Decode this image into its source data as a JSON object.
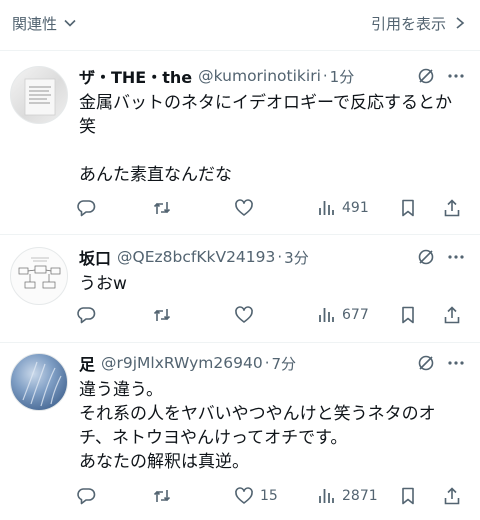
{
  "topbar": {
    "sort_label": "関連性",
    "quote_label": "引用を表示"
  },
  "replies": [
    {
      "name": "ザ・THE・the",
      "handle": "@kumorinotikiri",
      "dot": "·",
      "time": "1分",
      "text": "金属バットのネタにイデオロギーで反応するとか笑\n\nあんた素直なんだな",
      "likes": "",
      "views": "491"
    },
    {
      "name": "坂口",
      "handle": "@QEz8bcfKkV24193",
      "dot": "·",
      "time": "3分",
      "text": "うおw",
      "likes": "",
      "views": "677"
    },
    {
      "name": "足",
      "handle": "@r9jMlxRWym26940",
      "dot": "·",
      "time": "7分",
      "text": "違う違う。\nそれ系の人をヤバいやつやんけと笑うネタのオチ、ネトウヨやんけってオチです。\nあなたの解釈は真逆。",
      "likes": "15",
      "views": "2871"
    }
  ],
  "colors": {
    "secondary_text": "#536471",
    "primary_text": "#0f1419",
    "divider": "#eff3f4"
  },
  "icons": [
    "chevron-down-icon",
    "chevron-right-icon",
    "mute-icon",
    "more-icon",
    "reply-icon",
    "retweet-icon",
    "like-icon",
    "views-icon",
    "bookmark-icon",
    "share-icon"
  ]
}
